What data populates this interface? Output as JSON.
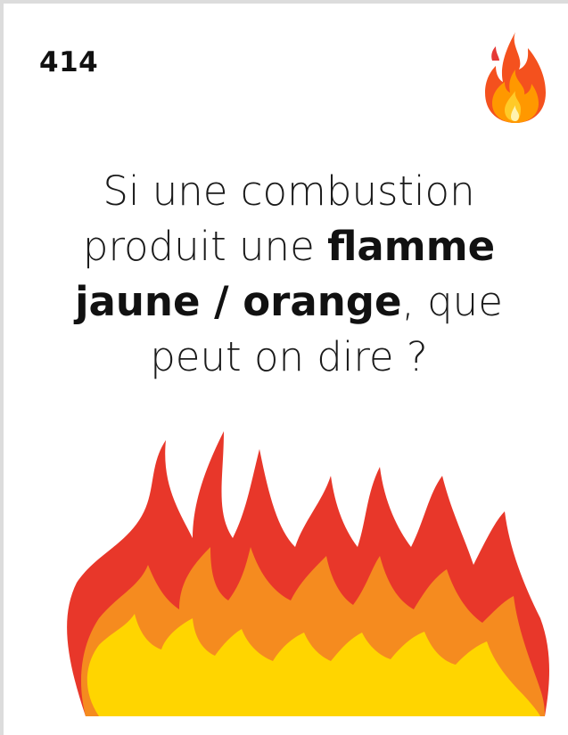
{
  "card": {
    "number": "414",
    "question": {
      "line1": "Si une combustion",
      "line2_normal": "produit une",
      "line2_bold": "flamme",
      "line3_bold": "jaune / orange",
      "line3_normal": ", que",
      "line4": "peut on dire ?"
    },
    "icons": {
      "corner": "fire-emoji-icon",
      "illustration": "flames-illustration-icon"
    },
    "colors": {
      "flame_red": "#E8372A",
      "flame_orange": "#F58B1F",
      "flame_yellow": "#FFD500"
    }
  }
}
